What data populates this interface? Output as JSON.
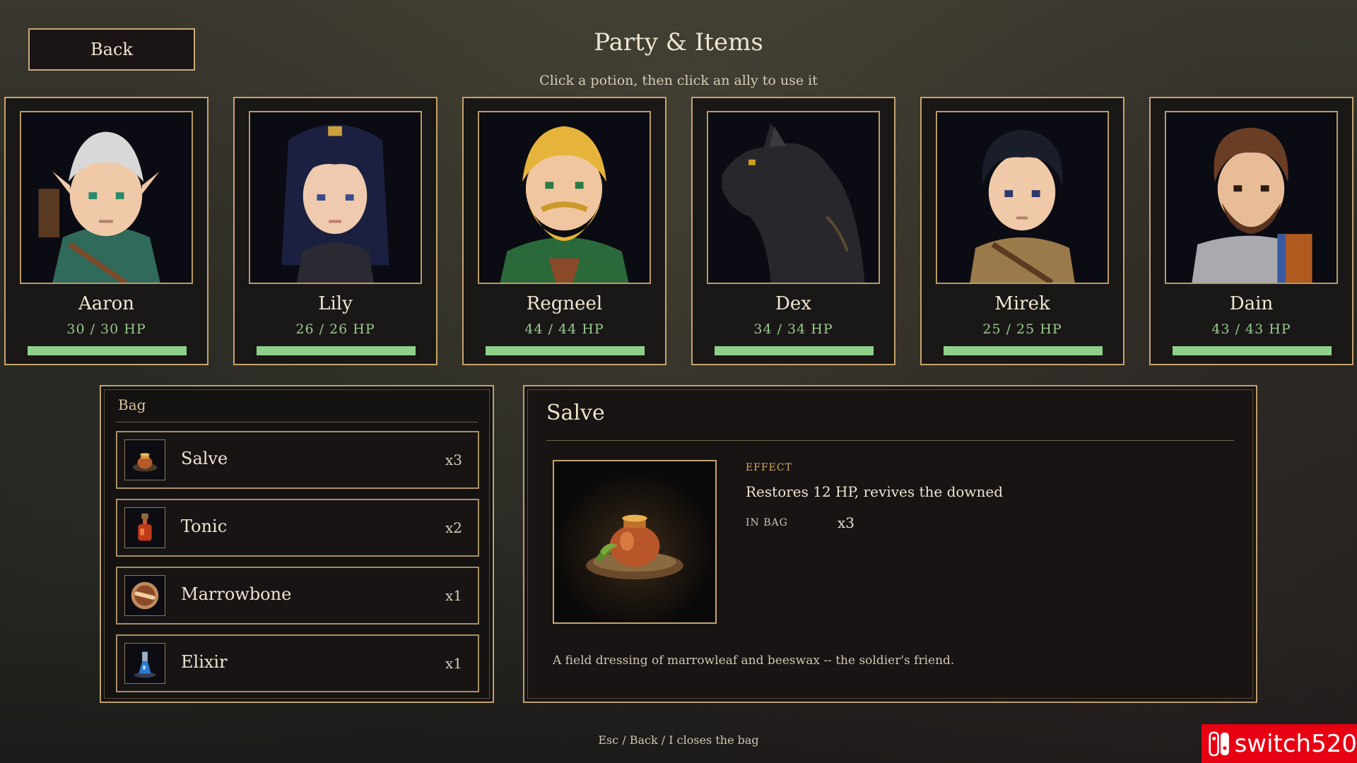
{
  "header": {
    "back_label": "Back",
    "title": "Party & Items",
    "subtitle": "Click a potion, then click an ally to use it"
  },
  "party": [
    {
      "name": "Aaron",
      "hp_text": "30 / 30  HP",
      "hp_fraction": 1.0
    },
    {
      "name": "Lily",
      "hp_text": "26 / 26  HP",
      "hp_fraction": 1.0
    },
    {
      "name": "Regneel",
      "hp_text": "44 / 44  HP",
      "hp_fraction": 1.0
    },
    {
      "name": "Dex",
      "hp_text": "34 / 34  HP",
      "hp_fraction": 1.0
    },
    {
      "name": "Mirek",
      "hp_text": "25 / 25  HP",
      "hp_fraction": 1.0
    },
    {
      "name": "Dain",
      "hp_text": "43 / 43  HP",
      "hp_fraction": 1.0
    }
  ],
  "bag": {
    "title": "Bag",
    "items": [
      {
        "name": "Salve",
        "count": "x3",
        "icon": "salve-pot-icon"
      },
      {
        "name": "Tonic",
        "count": "x2",
        "icon": "tonic-bottle-icon"
      },
      {
        "name": "Marrowbone",
        "count": "x1",
        "icon": "marrowbone-icon"
      },
      {
        "name": "Elixir",
        "count": "x1",
        "icon": "elixir-flask-icon"
      }
    ]
  },
  "detail": {
    "title": "Salve",
    "effect_label": "EFFECT",
    "effect_text": "Restores 12 HP, revives the downed",
    "inbag_label": "IN BAG",
    "inbag_value": "x3",
    "flavor": "A field dressing of marrowleaf and beeswax -- the soldier's friend."
  },
  "footer": "Esc / Back / I closes the bag",
  "watermark": "switch520",
  "colors": {
    "gold_border": "#c6a46c",
    "hp_green": "#8ed08a",
    "panel_bg": "#181414",
    "watermark_red": "#e60012"
  }
}
